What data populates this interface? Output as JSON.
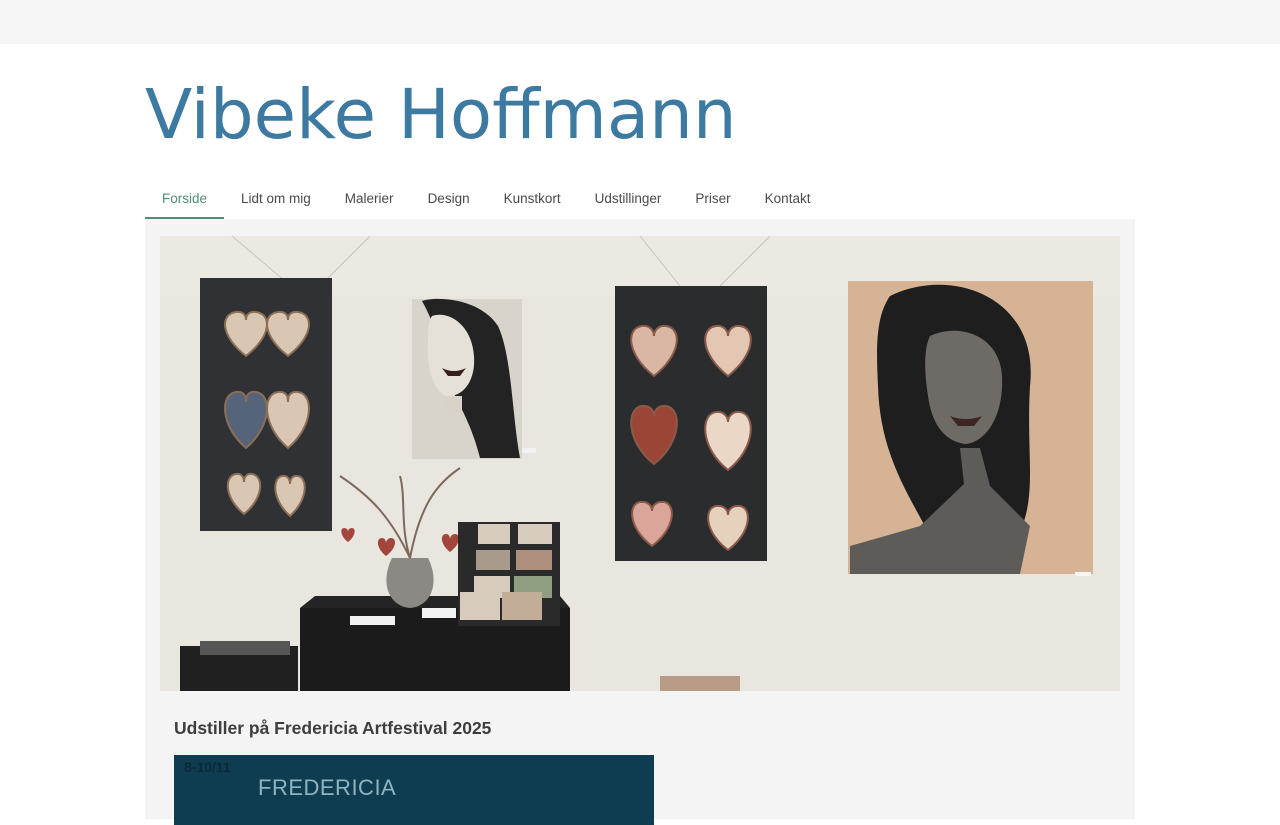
{
  "site": {
    "title": "Vibeke Hoffmann"
  },
  "nav": {
    "items": [
      {
        "label": "Forside",
        "active": true
      },
      {
        "label": "Lidt om mig"
      },
      {
        "label": "Malerier"
      },
      {
        "label": "Design"
      },
      {
        "label": "Kunstkort"
      },
      {
        "label": "Udstillinger"
      },
      {
        "label": "Priser"
      },
      {
        "label": "Kontakt"
      }
    ]
  },
  "main": {
    "hero_image": "exhibition-photo",
    "heading": "Udstiller på Fredericia Artfestival 2025",
    "poster": {
      "date": "8-10/11",
      "title": "FREDERICIA"
    }
  },
  "colors": {
    "title": "#3d7aa2",
    "nav_active": "#4f8f78",
    "poster_bg": "#0e3d52"
  }
}
